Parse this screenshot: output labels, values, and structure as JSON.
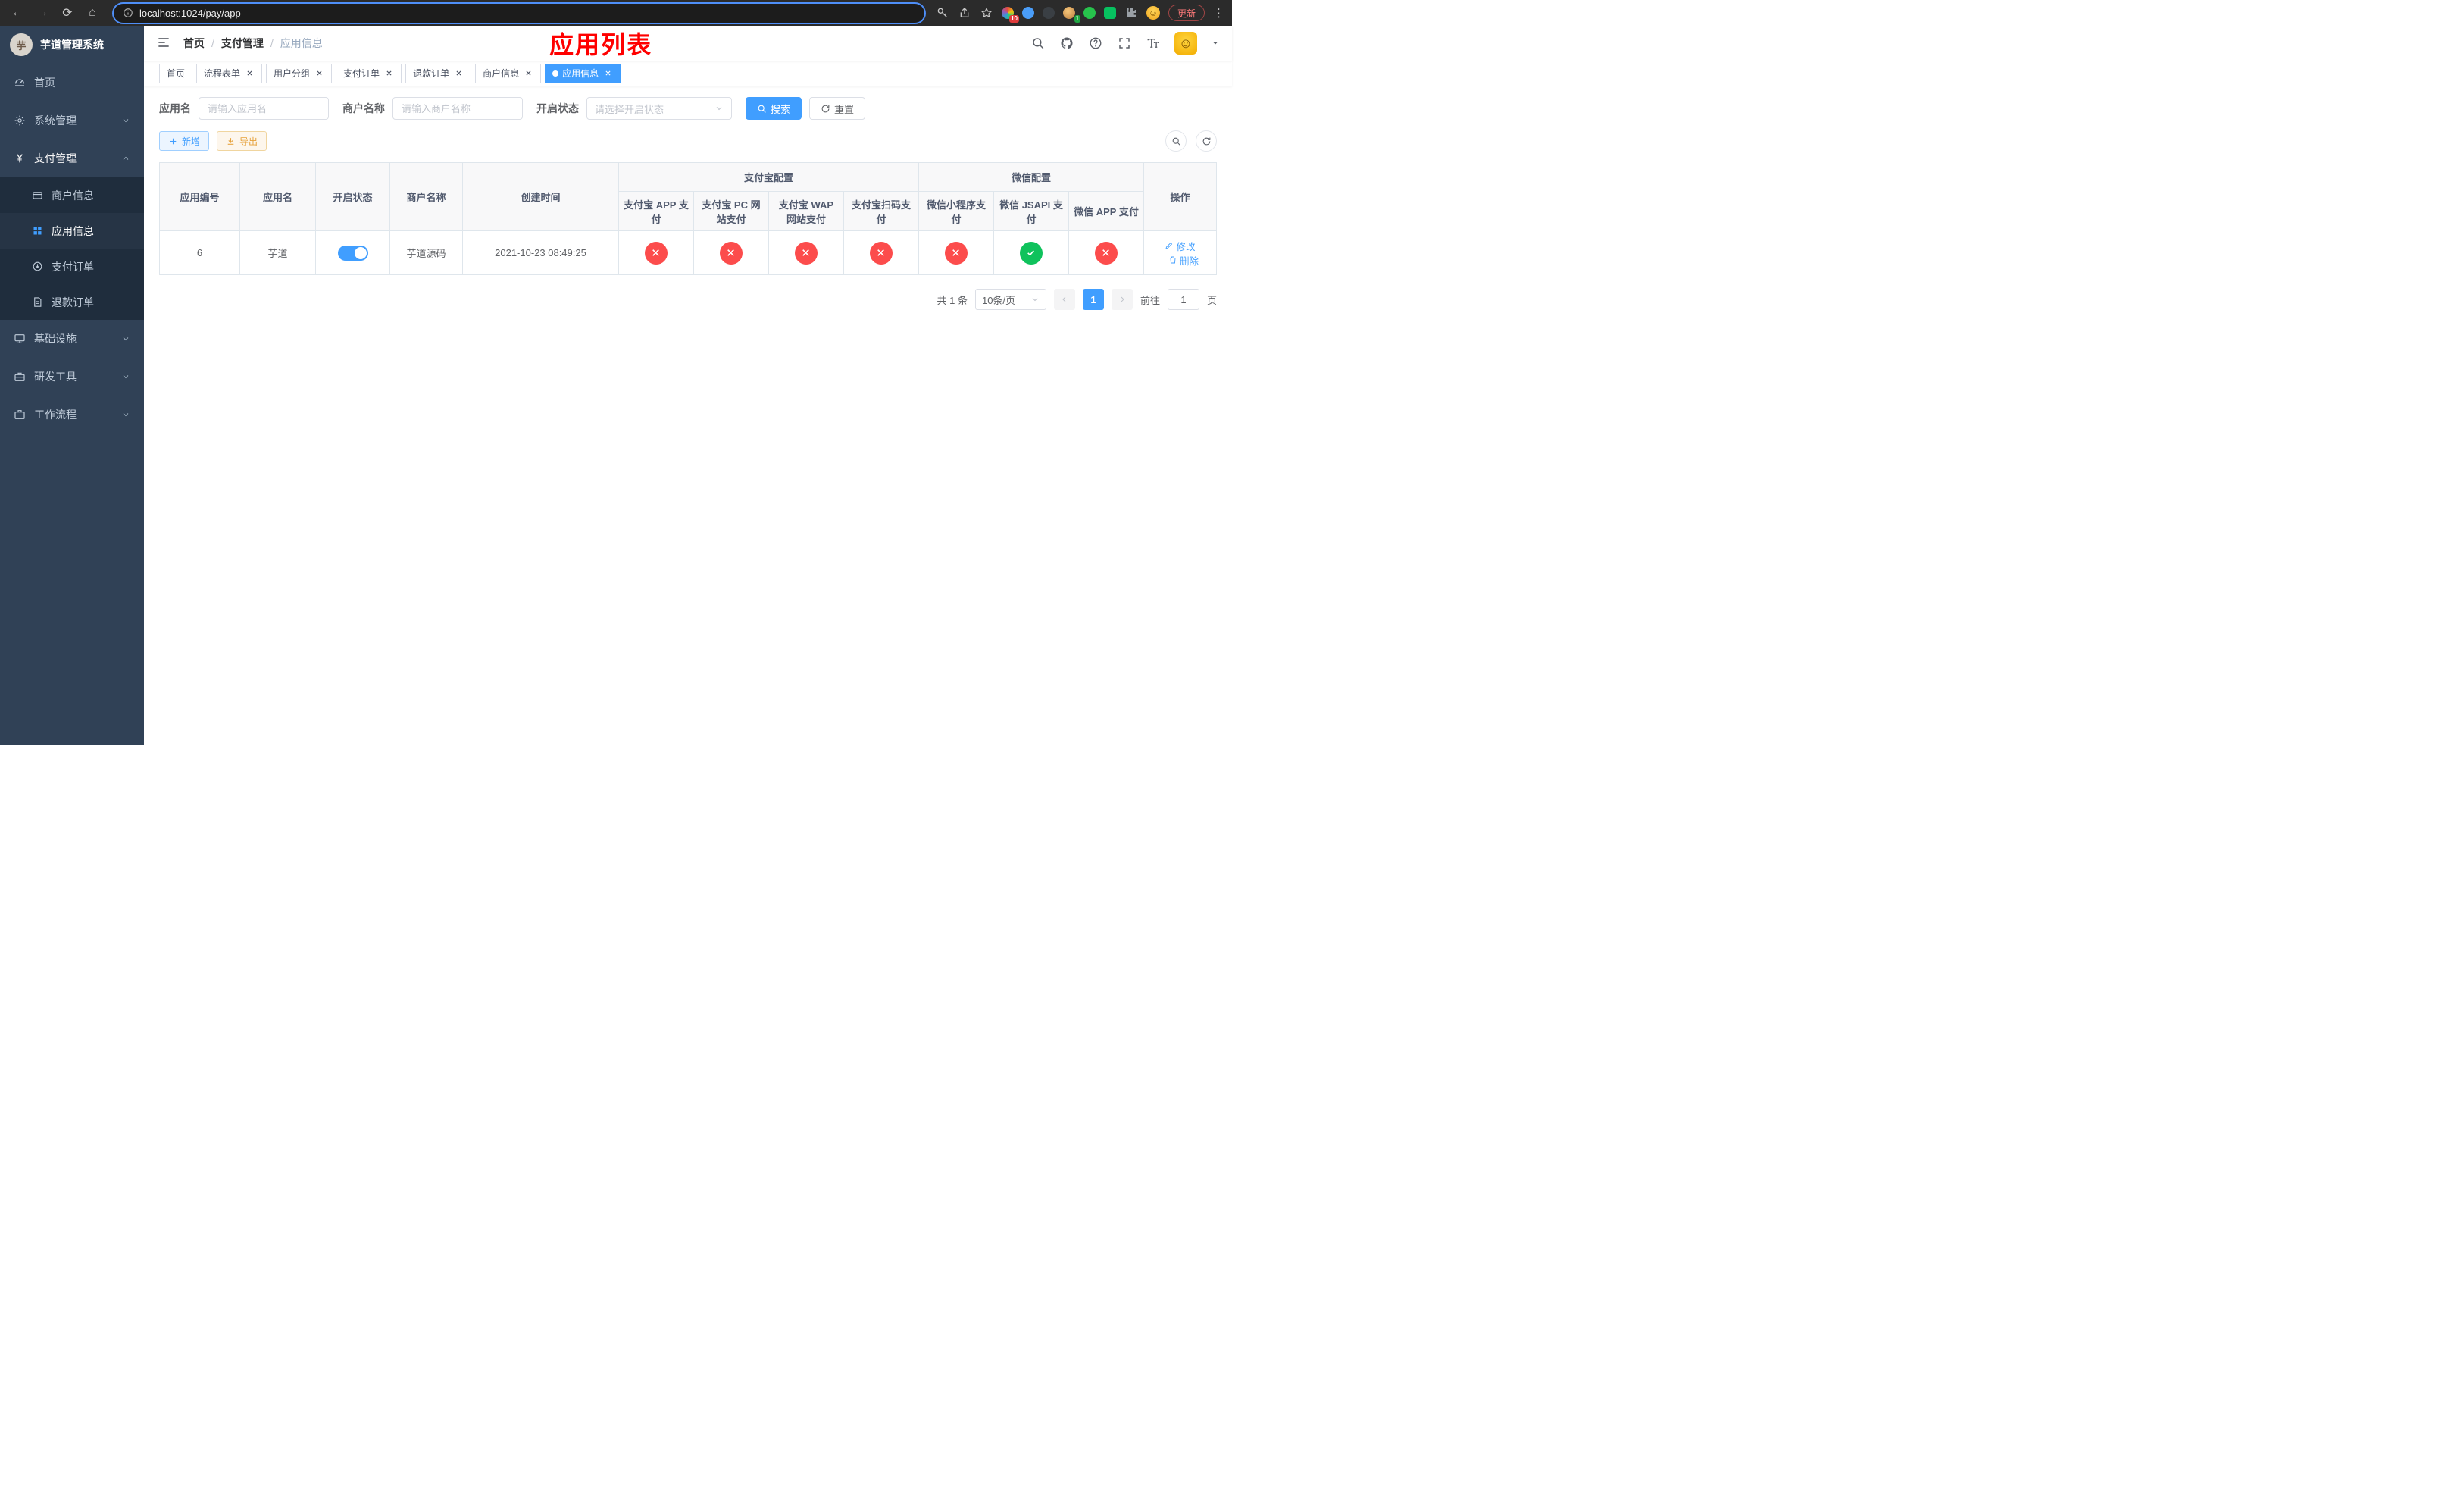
{
  "colors": {
    "accent": "#409eff",
    "danger": "#fc4c4c",
    "success": "#0fc25c",
    "sidebar_bg": "#304156",
    "submenu_bg": "#1f2d3d",
    "title_red": "#ff0000"
  },
  "browser": {
    "url": "localhost:1024/pay/app",
    "update_label": "更新",
    "ext_badge_red": "10",
    "ext_badge_green": "1"
  },
  "app": {
    "title": "芋道管理系统"
  },
  "sidebar": {
    "home": "首页",
    "system": "系统管理",
    "pay": "支付管理",
    "infra": "基础设施",
    "devtools": "研发工具",
    "workflow": "工作流程",
    "merchant_info": "商户信息",
    "app_info": "应用信息",
    "pay_order": "支付订单",
    "refund_order": "退款订单"
  },
  "header": {
    "breadcrumb_home": "首页",
    "breadcrumb_section": "支付管理",
    "breadcrumb_current": "应用信息",
    "overlay_title": "应用列表"
  },
  "tabs": [
    {
      "label": "首页"
    },
    {
      "label": "流程表单"
    },
    {
      "label": "用户分组"
    },
    {
      "label": "支付订单"
    },
    {
      "label": "退款订单"
    },
    {
      "label": "商户信息"
    },
    {
      "label": "应用信息"
    }
  ],
  "filters": {
    "app_name_label": "应用名",
    "app_name_placeholder": "请输入应用名",
    "merchant_label": "商户名称",
    "merchant_placeholder": "请输入商户名称",
    "status_label": "开启状态",
    "status_placeholder": "请选择开启状态",
    "search_label": "搜索",
    "reset_label": "重置"
  },
  "toolbar": {
    "add_label": "新增",
    "export_label": "导出"
  },
  "table": {
    "cols": {
      "app_id": "应用编号",
      "app_name": "应用名",
      "status": "开启状态",
      "merchant": "商户名称",
      "created": "创建时间",
      "alipay_group": "支付宝配置",
      "wechat_group": "微信配置",
      "alipay_app": "支付宝 APP 支付",
      "alipay_pc": "支付宝 PC 网站支付",
      "alipay_wap": "支付宝 WAP 网站支付",
      "alipay_qr": "支付宝扫码支付",
      "wx_mini": "微信小程序支付",
      "wx_jsapi": "微信 JSAPI 支付",
      "wx_app": "微信 APP 支付",
      "actions": "操作"
    },
    "row": {
      "app_id": "6",
      "app_name": "芋道",
      "status_on": true,
      "merchant": "芋道源码",
      "created": "2021-10-23 08:49:25",
      "configs": {
        "alipay_app": "disabled",
        "alipay_pc": "disabled",
        "alipay_wap": "disabled",
        "alipay_qr": "disabled",
        "wx_mini": "disabled",
        "wx_jsapi": "enabled",
        "wx_app": "disabled"
      },
      "edit_label": "修改",
      "delete_label": "删除"
    }
  },
  "pagination": {
    "total": "共 1 条",
    "page_size": "10条/页",
    "current_page": "1",
    "goto_label": "前往",
    "goto_value": "1",
    "unit_label": "页"
  }
}
